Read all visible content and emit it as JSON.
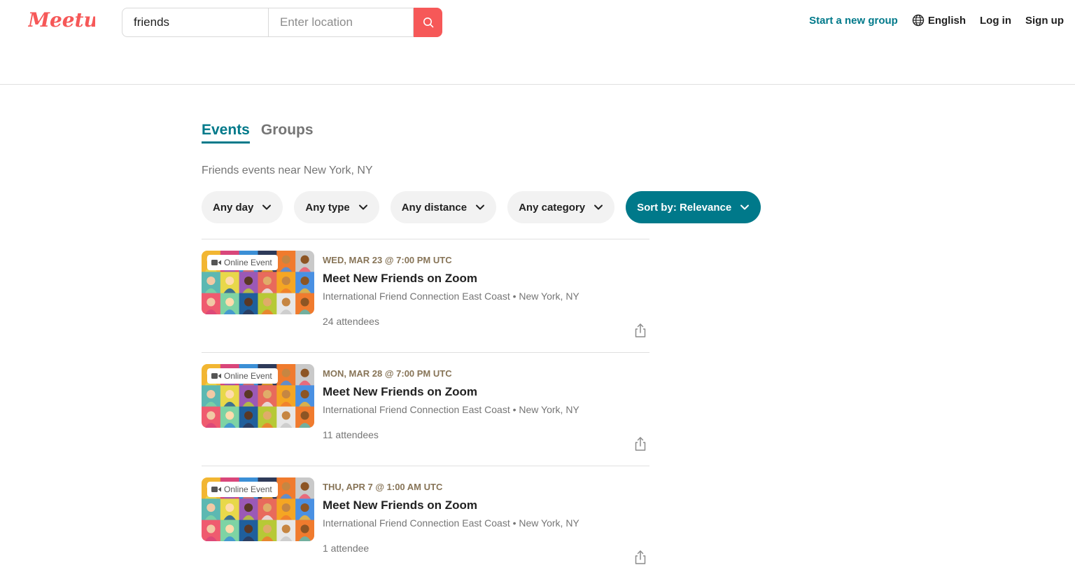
{
  "header": {
    "logo_text": "Meetup",
    "search_value": "friends",
    "location_placeholder": "Enter location",
    "start_group": "Start a new group",
    "language": "English",
    "login": "Log in",
    "signup": "Sign up"
  },
  "tabs": [
    {
      "label": "Events",
      "active": true
    },
    {
      "label": "Groups",
      "active": false
    }
  ],
  "subtitle": "Friends events near New York, NY",
  "filters": {
    "day": "Any day",
    "type": "Any type",
    "distance": "Any distance",
    "category": "Any category",
    "sort": "Sort by: Relevance"
  },
  "events": [
    {
      "badge": "Online Event",
      "date": "WED, MAR 23 @ 7:00 PM UTC",
      "title": "Meet New Friends on Zoom",
      "group": "International Friend Connection East Coast • New York, NY",
      "attendees": "24 attendees"
    },
    {
      "badge": "Online Event",
      "date": "MON, MAR 28 @ 7:00 PM UTC",
      "title": "Meet New Friends on Zoom",
      "group": "International Friend Connection East Coast • New York, NY",
      "attendees": "11 attendees"
    },
    {
      "badge": "Online Event",
      "date": "THU, APR 7 @ 1:00 AM UTC",
      "title": "Meet New Friends on Zoom",
      "group": "International Friend Connection East Coast • New York, NY",
      "attendees": "1 attendee"
    }
  ],
  "colors": {
    "brand": "#f65858",
    "teal": "#00798a",
    "date": "#877457"
  }
}
